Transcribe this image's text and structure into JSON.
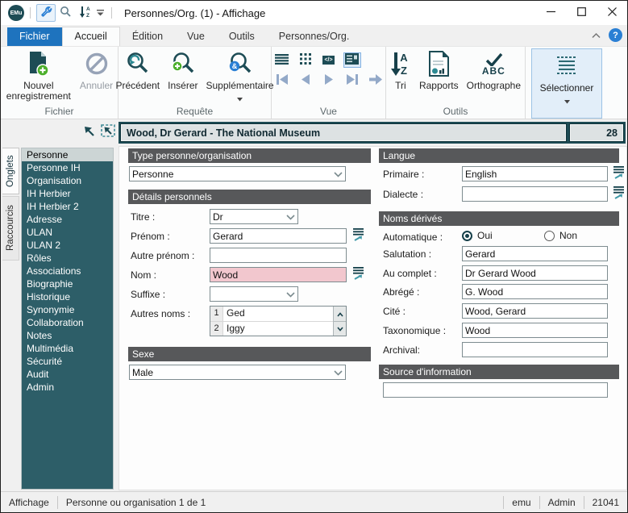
{
  "window": {
    "title": "Personnes/Org. (1) - Affichage",
    "logo_text": "EMu"
  },
  "menu_tabs": {
    "fichier": "Fichier",
    "accueil": "Accueil",
    "edition": "Édition",
    "vue": "Vue",
    "outils": "Outils",
    "module": "Personnes/Org."
  },
  "help": {
    "label": "?"
  },
  "ribbon": {
    "fichier_group": {
      "label": "Fichier",
      "new_record": "Nouvel enregistrement",
      "cancel": "Annuler"
    },
    "requete_group": {
      "label": "Requête",
      "previous": "Précédent",
      "insert": "Insérer",
      "supplementary": "Supplémentaire",
      "supp_badge": "&"
    },
    "vue_group": {
      "label": "Vue",
      "code_glyph": "</>"
    },
    "outils_group": {
      "label": "Outils",
      "sort": "Tri",
      "sort_a": "A",
      "sort_z": "Z",
      "reports": "Rapports",
      "spelling": "Orthographe",
      "abc": "ABC"
    },
    "select_button": {
      "label": "Sélectionner"
    }
  },
  "record_bar": {
    "title": "Wood, Dr Gerard - The National Museum",
    "number": "28"
  },
  "side_tabs": {
    "onglets": "Onglets",
    "raccourcis": "Raccourcis"
  },
  "sidebar": {
    "selected": "Personne",
    "items": [
      "Personne",
      "Personne IH",
      "Organisation",
      "IH Herbier",
      "IH Herbier 2",
      "Adresse",
      "ULAN",
      "ULAN 2",
      "Rôles",
      "Associations",
      "Biographie",
      "Historique",
      "Synonymie",
      "Collaboration",
      "Notes",
      "Multimédia",
      "Sécurité",
      "Audit",
      "Admin"
    ]
  },
  "form": {
    "type_section": {
      "title": "Type personne/organisation",
      "value": "Personne"
    },
    "details_section": {
      "title": "Détails personnels",
      "titre": {
        "label": "Titre :",
        "value": "Dr"
      },
      "prenom": {
        "label": "Prénom :",
        "value": "Gerard"
      },
      "autre_prenom": {
        "label": "Autre prénom :",
        "value": ""
      },
      "nom": {
        "label": "Nom :",
        "value": "Wood"
      },
      "suffixe": {
        "label": "Suffixe :",
        "value": ""
      },
      "autres_noms": {
        "label": "Autres noms :",
        "rows": [
          {
            "num": "1",
            "value": "Ged"
          },
          {
            "num": "2",
            "value": "Iggy"
          }
        ]
      }
    },
    "sexe_section": {
      "title": "Sexe",
      "value": "Male"
    },
    "langue_section": {
      "title": "Langue",
      "primaire": {
        "label": "Primaire :",
        "value": "English"
      },
      "dialecte": {
        "label": "Dialecte :",
        "value": ""
      }
    },
    "noms_derives_section": {
      "title": "Noms dérivés",
      "automatique": {
        "label": "Automatique :",
        "oui": "Oui",
        "non": "Non",
        "selected": "Oui"
      },
      "salutation": {
        "label": "Salutation :",
        "value": "Gerard"
      },
      "au_complet": {
        "label": "Au complet :",
        "value": "Dr Gerard Wood"
      },
      "abrege": {
        "label": "Abrégé :",
        "value": "G. Wood"
      },
      "cite": {
        "label": "Cité :",
        "value": "Wood, Gerard"
      },
      "taxonomique": {
        "label": "Taxonomique :",
        "value": "Wood"
      },
      "archival": {
        "label": "Archival:",
        "value": ""
      }
    },
    "source_section": {
      "title": "Source d'information",
      "value": ""
    }
  },
  "status_bar": {
    "mode": "Affichage",
    "record_info": "Personne ou organisation 1 de 1",
    "db": "emu",
    "user": "Admin",
    "port": "21041"
  },
  "colors": {
    "teal_dark": "#1d4c55",
    "teal_sidebar": "#2d5e68",
    "section_header_gray": "#57585a",
    "tab_blue": "#1e73be",
    "invalid_field_pink": "#f2c7ce",
    "accent_green": "#4caf2c",
    "accent_blue": "#2a7fd4",
    "disabled_nav": "#93a9c8"
  },
  "icons": [
    "emu-logo",
    "wrench-icon",
    "search-icon",
    "sort-icon",
    "chevron-down-icon",
    "minimize-icon",
    "maximize-icon",
    "close-icon",
    "collapse-ribbon-icon",
    "help-icon",
    "new-record-icon",
    "cancel-icon",
    "search-previous-icon",
    "search-insert-icon",
    "search-supplementary-icon",
    "list-view-icon",
    "grid-view-icon",
    "code-view-icon",
    "details-view-icon",
    "first-record-icon",
    "previous-record-icon",
    "next-record-icon",
    "last-record-icon",
    "goto-record-icon",
    "sort-az-icon",
    "reports-icon",
    "spellcheck-icon",
    "select-icon",
    "attach-arrow-icon",
    "attach-box-icon",
    "lookup-list-icon",
    "scroll-up-icon",
    "scroll-down-icon",
    "radio-button"
  ]
}
